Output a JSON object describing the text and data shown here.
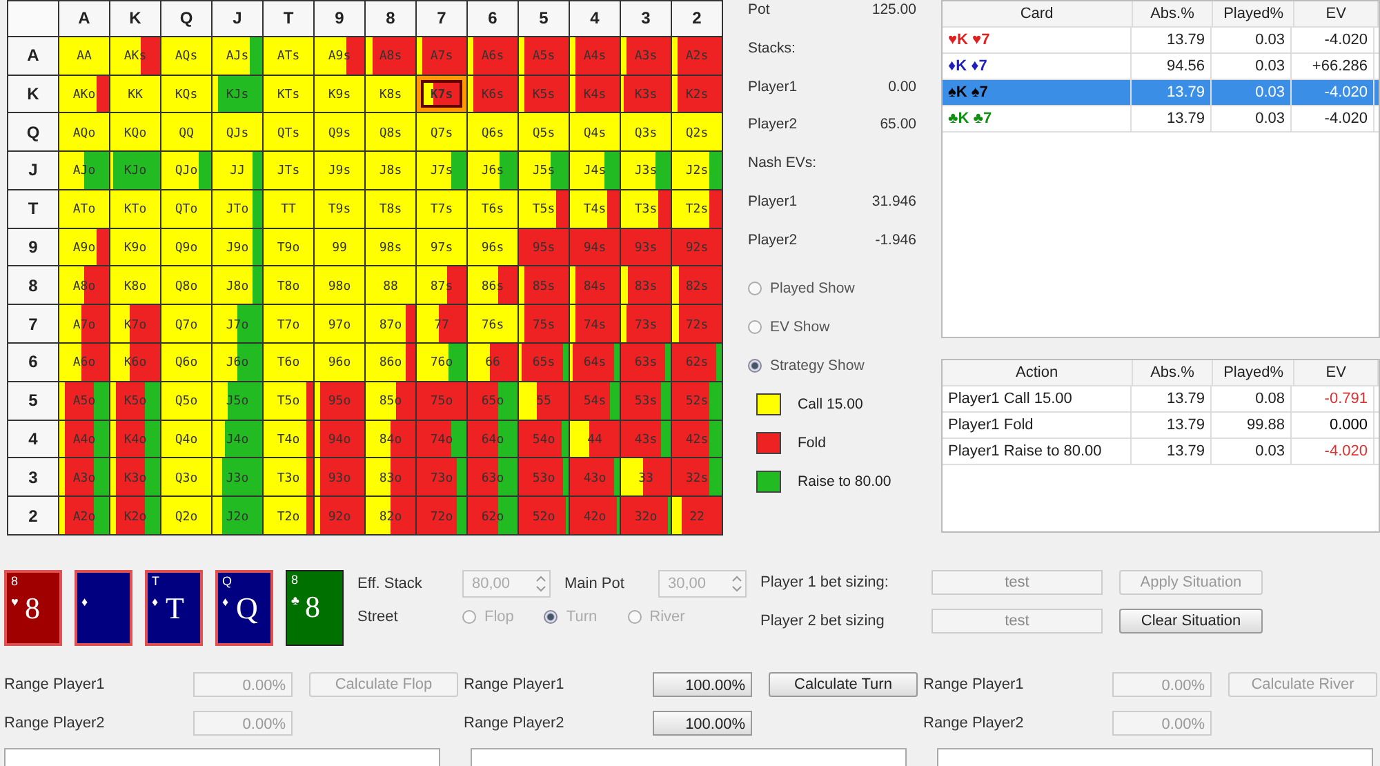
{
  "matrix": {
    "columns": [
      "A",
      "K",
      "Q",
      "J",
      "T",
      "9",
      "8",
      "7",
      "6",
      "5",
      "4",
      "3",
      "2"
    ],
    "rows": [
      {
        "label": "A",
        "cells": [
          {
            "hand": "AA",
            "selected": false,
            "call": {
              "level": 1
            }
          },
          {
            "hand": "AKs",
            "selected": false,
            "call": {
              "level": 0.6
            }
          },
          {
            "hand": "AQs",
            "selected": false,
            "call": {
              "level": 1
            }
          },
          {
            "hand": "AJs",
            "selected": false,
            "call": {
              "level": 0.75
            },
            "raise": {
              "level": 0.25
            }
          },
          {
            "hand": "ATs",
            "selected": false,
            "call": {
              "level": 1
            }
          },
          {
            "hand": "A9s",
            "selected": false,
            "call": {
              "level": 0.65
            }
          },
          {
            "hand": "A8s",
            "selected": false,
            "call": {
              "level": 0.15
            }
          },
          {
            "hand": "A7s",
            "selected": false,
            "call": {
              "level": 0.1
            }
          },
          {
            "hand": "A6s",
            "selected": false,
            "call": {
              "level": 0.1
            }
          },
          {
            "hand": "A5s",
            "selected": false,
            "call": {
              "level": 0.1
            }
          },
          {
            "hand": "A4s",
            "selected": false,
            "call": {
              "level": 0.1
            }
          },
          {
            "hand": "A3s",
            "selected": false,
            "call": {
              "level": 0.1
            }
          },
          {
            "hand": "A2s",
            "selected": false,
            "call": {
              "level": 0.1
            }
          }
        ]
      },
      {
        "label": "K",
        "cells": [
          {
            "hand": "AKo",
            "selected": false,
            "call": {
              "level": 0.75
            }
          },
          {
            "hand": "KK",
            "selected": false,
            "call": {
              "level": 1
            }
          },
          {
            "hand": "KQs",
            "selected": false,
            "call": {
              "level": 1
            }
          },
          {
            "hand": "KJs",
            "selected": false,
            "call": {
              "level": 0.1
            },
            "raise": {
              "level": 0.9
            }
          },
          {
            "hand": "KTs",
            "selected": false,
            "call": {
              "level": 1
            }
          },
          {
            "hand": "K9s",
            "selected": false,
            "call": {
              "level": 1
            }
          },
          {
            "hand": "K8s",
            "selected": false,
            "call": {
              "level": 1
            }
          },
          {
            "hand": "K7s",
            "selected": true,
            "call": {
              "level": 0.2
            }
          },
          {
            "hand": "K6s",
            "selected": false,
            "call": {
              "level": 0.1
            }
          },
          {
            "hand": "K5s",
            "selected": false,
            "call": {
              "level": 0.1
            }
          },
          {
            "hand": "K4s",
            "selected": false,
            "call": {
              "level": 0.1
            }
          },
          {
            "hand": "K3s",
            "selected": false,
            "call": {
              "level": 0.05
            }
          },
          {
            "hand": "K2s",
            "selected": false,
            "call": {
              "level": 0.1
            }
          }
        ]
      },
      {
        "label": "Q",
        "cells": [
          {
            "hand": "AQo",
            "selected": false,
            "call": {
              "level": 1
            }
          },
          {
            "hand": "KQo",
            "selected": false,
            "call": {
              "level": 1
            }
          },
          {
            "hand": "QQ",
            "selected": false,
            "call": {
              "level": 1
            }
          },
          {
            "hand": "QJs",
            "selected": false,
            "call": {
              "level": 1
            }
          },
          {
            "hand": "QTs",
            "selected": false,
            "call": {
              "level": 1
            }
          },
          {
            "hand": "Q9s",
            "selected": false,
            "call": {
              "level": 1
            }
          },
          {
            "hand": "Q8s",
            "selected": false,
            "call": {
              "level": 1
            }
          },
          {
            "hand": "Q7s",
            "selected": false,
            "call": {
              "level": 1
            }
          },
          {
            "hand": "Q6s",
            "selected": false,
            "call": {
              "level": 1
            }
          },
          {
            "hand": "Q5s",
            "selected": false,
            "call": {
              "level": 1
            }
          },
          {
            "hand": "Q4s",
            "selected": false,
            "call": {
              "level": 1
            }
          },
          {
            "hand": "Q3s",
            "selected": false,
            "call": {
              "level": 1
            }
          },
          {
            "hand": "Q2s",
            "selected": false,
            "call": {
              "level": 1
            }
          }
        ]
      },
      {
        "label": "J",
        "cells": [
          {
            "hand": "AJo",
            "selected": false,
            "call": {
              "level": 0.5
            },
            "raise": {
              "level": 0.5
            }
          },
          {
            "hand": "KJo",
            "selected": false,
            "call": {
              "level": 0.05
            },
            "raise": {
              "level": 0.95
            }
          },
          {
            "hand": "QJo",
            "selected": false,
            "call": {
              "level": 0.75
            },
            "raise": {
              "level": 0.25
            }
          },
          {
            "hand": "JJ",
            "selected": false,
            "call": {
              "level": 0.8
            },
            "raise": {
              "level": 0.2
            }
          },
          {
            "hand": "JTs",
            "selected": false,
            "call": {
              "level": 1
            }
          },
          {
            "hand": "J9s",
            "selected": false,
            "call": {
              "level": 1
            }
          },
          {
            "hand": "J8s",
            "selected": false,
            "call": {
              "level": 1
            }
          },
          {
            "hand": "J7s",
            "selected": false,
            "call": {
              "level": 0.7
            },
            "raise": {
              "level": 0.3
            }
          },
          {
            "hand": "J6s",
            "selected": false,
            "call": {
              "level": 0.65
            },
            "raise": {
              "level": 0.35
            }
          },
          {
            "hand": "J5s",
            "selected": false,
            "call": {
              "level": 0.65
            },
            "raise": {
              "level": 0.35
            }
          },
          {
            "hand": "J4s",
            "selected": false,
            "call": {
              "level": 0.7
            },
            "raise": {
              "level": 0.3
            }
          },
          {
            "hand": "J3s",
            "selected": false,
            "call": {
              "level": 0.7
            },
            "raise": {
              "level": 0.3
            }
          },
          {
            "hand": "J2s",
            "selected": false,
            "call": {
              "level": 0.75
            },
            "raise": {
              "level": 0.25
            }
          }
        ]
      },
      {
        "label": "T",
        "cells": [
          {
            "hand": "ATo",
            "selected": false,
            "call": {
              "level": 1
            }
          },
          {
            "hand": "KTo",
            "selected": false,
            "call": {
              "level": 1
            }
          },
          {
            "hand": "QTo",
            "selected": false,
            "call": {
              "level": 1
            }
          },
          {
            "hand": "JTo",
            "selected": false,
            "call": {
              "level": 0.8
            },
            "raise": {
              "level": 0.2
            }
          },
          {
            "hand": "TT",
            "selected": false,
            "call": {
              "level": 1
            }
          },
          {
            "hand": "T9s",
            "selected": false,
            "call": {
              "level": 1
            }
          },
          {
            "hand": "T8s",
            "selected": false,
            "call": {
              "level": 1
            }
          },
          {
            "hand": "T7s",
            "selected": false,
            "call": {
              "level": 1
            }
          },
          {
            "hand": "T6s",
            "selected": false,
            "call": {
              "level": 1
            }
          },
          {
            "hand": "T5s",
            "selected": false,
            "call": {
              "level": 0.75
            }
          },
          {
            "hand": "T4s",
            "selected": false,
            "call": {
              "level": 0.75
            }
          },
          {
            "hand": "T3s",
            "selected": false,
            "call": {
              "level": 0.75
            }
          },
          {
            "hand": "T2s",
            "selected": false,
            "call": {
              "level": 0.75
            }
          }
        ]
      },
      {
        "label": "9",
        "cells": [
          {
            "hand": "A9o",
            "selected": false,
            "call": {
              "level": 0.75
            }
          },
          {
            "hand": "K9o",
            "selected": false,
            "call": {
              "level": 1
            }
          },
          {
            "hand": "Q9o",
            "selected": false,
            "call": {
              "level": 1
            }
          },
          {
            "hand": "J9o",
            "selected": false,
            "call": {
              "level": 0.8
            },
            "raise": {
              "level": 0.2
            }
          },
          {
            "hand": "T9o",
            "selected": false,
            "call": {
              "level": 1
            }
          },
          {
            "hand": "99",
            "selected": false,
            "call": {
              "level": 1
            }
          },
          {
            "hand": "98s",
            "selected": false,
            "call": {
              "level": 1
            }
          },
          {
            "hand": "97s",
            "selected": false,
            "call": {
              "level": 1
            }
          },
          {
            "hand": "96s",
            "selected": false,
            "call": {
              "level": 1
            }
          },
          {
            "hand": "95s",
            "selected": false
          },
          {
            "hand": "94s",
            "selected": false
          },
          {
            "hand": "93s",
            "selected": false
          },
          {
            "hand": "92s",
            "selected": false
          }
        ]
      },
      {
        "label": "8",
        "cells": [
          {
            "hand": "A8o",
            "selected": false,
            "call": {
              "level": 0.5
            }
          },
          {
            "hand": "K8o",
            "selected": false,
            "call": {
              "level": 1
            }
          },
          {
            "hand": "Q8o",
            "selected": false,
            "call": {
              "level": 1
            }
          },
          {
            "hand": "J8o",
            "selected": false,
            "call": {
              "level": 0.8
            },
            "raise": {
              "level": 0.2
            }
          },
          {
            "hand": "T8o",
            "selected": false,
            "call": {
              "level": 1
            }
          },
          {
            "hand": "98o",
            "selected": false,
            "call": {
              "level": 1
            }
          },
          {
            "hand": "88",
            "selected": false,
            "call": {
              "level": 1
            }
          },
          {
            "hand": "87s",
            "selected": false,
            "call": {
              "level": 0.6
            }
          },
          {
            "hand": "86s",
            "selected": false,
            "call": {
              "level": 0.6
            }
          },
          {
            "hand": "85s",
            "selected": false,
            "call": {
              "level": 0.1
            }
          },
          {
            "hand": "84s",
            "selected": false,
            "call": {
              "level": 0.1
            }
          },
          {
            "hand": "83s",
            "selected": false,
            "call": {
              "level": 0.15
            }
          },
          {
            "hand": "82s",
            "selected": false,
            "call": {
              "level": 0.15
            }
          }
        ]
      },
      {
        "label": "7",
        "cells": [
          {
            "hand": "A7o",
            "selected": false,
            "call": {
              "level": 0.45
            }
          },
          {
            "hand": "K7o",
            "selected": false,
            "call": {
              "level": 0.4
            }
          },
          {
            "hand": "Q7o",
            "selected": false,
            "call": {
              "level": 1
            }
          },
          {
            "hand": "J7o",
            "selected": false,
            "call": {
              "level": 0.5
            },
            "raise": {
              "level": 0.5
            }
          },
          {
            "hand": "T7o",
            "selected": false,
            "call": {
              "level": 1
            }
          },
          {
            "hand": "97o",
            "selected": false,
            "call": {
              "level": 1
            }
          },
          {
            "hand": "87o",
            "selected": false,
            "call": {
              "level": 0.8
            }
          },
          {
            "hand": "77",
            "selected": false,
            "call": {
              "level": 0.45
            }
          },
          {
            "hand": "76s",
            "selected": false,
            "call": {
              "level": 1
            }
          },
          {
            "hand": "75s",
            "selected": false,
            "call": {
              "level": 0.1
            }
          },
          {
            "hand": "74s",
            "selected": false,
            "call": {
              "level": 0.1
            }
          },
          {
            "hand": "73s",
            "selected": false,
            "call": {
              "level": 0.1
            }
          },
          {
            "hand": "72s",
            "selected": false,
            "call": {
              "level": 0.15
            }
          }
        ]
      },
      {
        "label": "6",
        "cells": [
          {
            "hand": "A6o",
            "selected": false,
            "call": {
              "level": 0.45
            }
          },
          {
            "hand": "K6o",
            "selected": false,
            "call": {
              "level": 0.4
            }
          },
          {
            "hand": "Q6o",
            "selected": false,
            "call": {
              "level": 1
            }
          },
          {
            "hand": "J6o",
            "selected": false,
            "call": {
              "level": 0.5
            },
            "raise": {
              "level": 0.5
            }
          },
          {
            "hand": "T6o",
            "selected": false,
            "call": {
              "level": 1
            }
          },
          {
            "hand": "96o",
            "selected": false,
            "call": {
              "level": 1
            }
          },
          {
            "hand": "86o",
            "selected": false,
            "call": {
              "level": 0.8
            }
          },
          {
            "hand": "76o",
            "selected": false,
            "call": {
              "level": 0.65
            },
            "raise": {
              "level": 0.35
            }
          },
          {
            "hand": "66",
            "selected": false,
            "call": {
              "level": 0.45
            }
          },
          {
            "hand": "65s",
            "selected": false,
            "call": {
              "level": 0.05
            },
            "raise": {
              "level": 0.1
            }
          },
          {
            "hand": "64s",
            "selected": false,
            "call": {
              "level": 0.05
            },
            "raise": {
              "level": 0.1
            }
          },
          {
            "hand": "63s",
            "selected": false,
            "raise": {
              "level": 0.1
            }
          },
          {
            "hand": "62s",
            "selected": false,
            "raise": {
              "level": 0.1
            }
          }
        ]
      },
      {
        "label": "5",
        "cells": [
          {
            "hand": "A5o",
            "selected": false,
            "call": {
              "level": 0.1
            },
            "raise": {
              "level": 0.3
            }
          },
          {
            "hand": "K5o",
            "selected": false,
            "call": {
              "level": 0.1
            },
            "raise": {
              "level": 0.3
            }
          },
          {
            "hand": "Q5o",
            "selected": false,
            "call": {
              "level": 1
            }
          },
          {
            "hand": "J5o",
            "selected": false,
            "call": {
              "level": 0.3
            },
            "raise": {
              "level": 0.7
            }
          },
          {
            "hand": "T5o",
            "selected": false,
            "call": {
              "level": 0.85
            }
          },
          {
            "hand": "95o",
            "selected": false,
            "call": {
              "level": 0.1
            }
          },
          {
            "hand": "85o",
            "selected": false,
            "call": {
              "level": 0.6
            }
          },
          {
            "hand": "75o",
            "selected": false
          },
          {
            "hand": "65o",
            "selected": false,
            "raise": {
              "level": 0.4
            }
          },
          {
            "hand": "55",
            "selected": false,
            "call": {
              "level": 0.35
            }
          },
          {
            "hand": "54s",
            "selected": false,
            "raise": {
              "level": 0.2
            }
          },
          {
            "hand": "53s",
            "selected": false,
            "raise": {
              "level": 0.2
            }
          },
          {
            "hand": "52s",
            "selected": false,
            "raise": {
              "level": 0.25
            }
          }
        ]
      },
      {
        "label": "4",
        "cells": [
          {
            "hand": "A4o",
            "selected": false,
            "call": {
              "level": 0.1
            },
            "raise": {
              "level": 0.3
            }
          },
          {
            "hand": "K4o",
            "selected": false,
            "call": {
              "level": 0.1
            },
            "raise": {
              "level": 0.3
            }
          },
          {
            "hand": "Q4o",
            "selected": false,
            "call": {
              "level": 1
            }
          },
          {
            "hand": "J4o",
            "selected": false,
            "call": {
              "level": 0.25
            },
            "raise": {
              "level": 0.75
            }
          },
          {
            "hand": "T4o",
            "selected": false,
            "call": {
              "level": 0.85
            }
          },
          {
            "hand": "94o",
            "selected": false,
            "call": {
              "level": 0.1
            }
          },
          {
            "hand": "84o",
            "selected": false,
            "call": {
              "level": 0.5
            }
          },
          {
            "hand": "74o",
            "selected": false,
            "raise": {
              "level": 0.3
            }
          },
          {
            "hand": "64o",
            "selected": false,
            "raise": {
              "level": 0.4
            }
          },
          {
            "hand": "54o",
            "selected": false,
            "raise": {
              "level": 0.15
            }
          },
          {
            "hand": "44",
            "selected": false,
            "call": {
              "level": 0.4
            }
          },
          {
            "hand": "43s",
            "selected": false,
            "raise": {
              "level": 0.2
            }
          },
          {
            "hand": "42s",
            "selected": false,
            "raise": {
              "level": 0.25
            }
          }
        ]
      },
      {
        "label": "3",
        "cells": [
          {
            "hand": "A3o",
            "selected": false,
            "call": {
              "level": 0.1
            },
            "raise": {
              "level": 0.3
            }
          },
          {
            "hand": "K3o",
            "selected": false,
            "call": {
              "level": 0.1
            },
            "raise": {
              "level": 0.3
            }
          },
          {
            "hand": "Q3o",
            "selected": false,
            "call": {
              "level": 1
            }
          },
          {
            "hand": "J3o",
            "selected": false,
            "call": {
              "level": 0.2
            },
            "raise": {
              "level": 0.8
            }
          },
          {
            "hand": "T3o",
            "selected": false,
            "call": {
              "level": 0.85
            }
          },
          {
            "hand": "93o",
            "selected": false,
            "call": {
              "level": 0.1
            }
          },
          {
            "hand": "83o",
            "selected": false,
            "call": {
              "level": 0.5
            }
          },
          {
            "hand": "73o",
            "selected": false,
            "raise": {
              "level": 0.2
            }
          },
          {
            "hand": "63o",
            "selected": false,
            "raise": {
              "level": 0.4
            }
          },
          {
            "hand": "53o",
            "selected": false,
            "raise": {
              "level": 0.1
            }
          },
          {
            "hand": "43o",
            "selected": false,
            "raise": {
              "level": 0.1
            }
          },
          {
            "hand": "33",
            "selected": false,
            "call": {
              "level": 0.45
            }
          },
          {
            "hand": "32s",
            "selected": false,
            "raise": {
              "level": 0.25
            }
          }
        ]
      },
      {
        "label": "2",
        "cells": [
          {
            "hand": "A2o",
            "selected": false,
            "call": {
              "level": 0.1
            },
            "raise": {
              "level": 0.3
            }
          },
          {
            "hand": "K2o",
            "selected": false,
            "call": {
              "level": 0.1
            },
            "raise": {
              "level": 0.3
            }
          },
          {
            "hand": "Q2o",
            "selected": false,
            "call": {
              "level": 1
            }
          },
          {
            "hand": "J2o",
            "selected": false,
            "call": {
              "level": 0.2
            },
            "raise": {
              "level": 0.8
            }
          },
          {
            "hand": "T2o",
            "selected": false,
            "call": {
              "level": 0.85
            }
          },
          {
            "hand": "92o",
            "selected": false,
            "call": {
              "level": 0.1
            }
          },
          {
            "hand": "82o",
            "selected": false,
            "call": {
              "level": 0.5
            }
          },
          {
            "hand": "72o",
            "selected": false,
            "raise": {
              "level": 0.2
            }
          },
          {
            "hand": "62o",
            "selected": false,
            "raise": {
              "level": 0.4
            }
          },
          {
            "hand": "52o",
            "selected": false,
            "raise": {
              "level": 0.05
            }
          },
          {
            "hand": "42o",
            "selected": false,
            "raise": {
              "level": 0.05
            }
          },
          {
            "hand": "32o",
            "selected": false,
            "raise": {
              "level": 0.05
            }
          },
          {
            "hand": "22",
            "selected": false,
            "call": {
              "level": 0.2
            }
          }
        ]
      }
    ]
  },
  "info": {
    "rows": [
      {
        "label": "Pot",
        "value": "125.00"
      },
      {
        "label": "Stacks:"
      },
      {
        "label": "Player1",
        "value": "0.00"
      },
      {
        "label": "Player2",
        "value": "65.00"
      },
      {
        "label": "Nash EVs:"
      },
      {
        "label": "Player1",
        "value": "31.946"
      },
      {
        "label": "Player2",
        "value": "-1.946"
      }
    ],
    "views": [
      {
        "label": "Played Show",
        "selected": false
      },
      {
        "label": "EV Show",
        "selected": false
      },
      {
        "label": "Strategy Show",
        "selected": true
      }
    ],
    "legend": [
      {
        "label": "Call 15.00",
        "color": "#ffff00"
      },
      {
        "label": "Fold",
        "color": "#ee2222"
      },
      {
        "label": "Raise to 80.00",
        "color": "#22bb22"
      }
    ]
  },
  "card_table": {
    "columns": [
      "Card",
      "Abs.%",
      "Played%",
      "EV"
    ],
    "rows": [
      {
        "card": "♥K ♥7",
        "color": "#e02020",
        "abs": "13.79",
        "played": "0.03",
        "ev": "-4.020",
        "selected": false
      },
      {
        "card": "♦K ♦7",
        "color": "#2020c0",
        "abs": "94.56",
        "played": "0.03",
        "ev": "+66.286",
        "selected": false
      },
      {
        "card": "♠K ♠7",
        "color": "#000000",
        "abs": "13.79",
        "played": "0.03",
        "ev": "-4.020",
        "selected": true
      },
      {
        "card": "♣K ♣7",
        "color": "#109010",
        "abs": "13.79",
        "played": "0.03",
        "ev": "-4.020",
        "selected": false
      }
    ]
  },
  "action_table": {
    "columns": [
      "Action",
      "Abs.%",
      "Played%",
      "EV"
    ],
    "rows": [
      {
        "action": "Player1 Call 15.00",
        "abs": "13.79",
        "played": "0.08",
        "ev": "-0.791",
        "color": "#e03030"
      },
      {
        "action": "Player1 Fold",
        "abs": "13.79",
        "played": "99.88",
        "ev": "0.000",
        "color": "#000000"
      },
      {
        "action": "Player1 Raise to 80.00",
        "abs": "13.79",
        "played": "0.03",
        "ev": "-4.020",
        "color": "#e03030"
      }
    ]
  },
  "board": [
    {
      "rank": "8",
      "suit": "♥",
      "face": "8",
      "color": "#a00000",
      "selected": true
    },
    {
      "suit": "♦",
      "color": "#000080",
      "selected": true
    },
    {
      "rank": "T",
      "suit": "♦",
      "face": "T",
      "color": "#000080",
      "selected": true
    },
    {
      "rank": "Q",
      "suit": "♦",
      "face": "Q",
      "color": "#000080",
      "selected": true
    },
    {
      "rank": "8",
      "suit": "♣",
      "face": "8",
      "color": "#007000",
      "selected": false
    }
  ],
  "situation": {
    "eff_stack": {
      "label": "Eff. Stack",
      "value": "80,00",
      "disabled": true
    },
    "main_pot": {
      "label": "Main Pot",
      "value": "30,00",
      "disabled": true
    },
    "street": {
      "label": "Street",
      "disabled": true,
      "options": [
        {
          "label": "Flop",
          "selected": false
        },
        {
          "label": "Turn",
          "selected": true
        },
        {
          "label": "River",
          "selected": false
        }
      ]
    },
    "bets": [
      {
        "label": "Player 1 bet sizing:",
        "value": "test",
        "button": "Apply Situation",
        "disabled": true
      },
      {
        "label": "Player 2 bet sizing",
        "value": "test",
        "button": "Clear Situation",
        "disabled": false
      }
    ]
  },
  "ranges": [
    {
      "disabled": true,
      "button": "Calculate Flop",
      "rows": [
        {
          "label": "Range Player1",
          "value": "0.00%"
        },
        {
          "label": "Range Player2",
          "value": "0.00%"
        }
      ]
    },
    {
      "disabled": false,
      "button": "Calculate Turn",
      "rows": [
        {
          "label": "Range Player1",
          "value": "100.00%"
        },
        {
          "label": "Range Player2",
          "value": "100.00%"
        }
      ]
    },
    {
      "disabled": true,
      "button": "Calculate River",
      "rows": [
        {
          "label": "Range Player1",
          "value": "0.00%"
        },
        {
          "label": "Range Player2",
          "value": "0.00%"
        }
      ]
    }
  ]
}
